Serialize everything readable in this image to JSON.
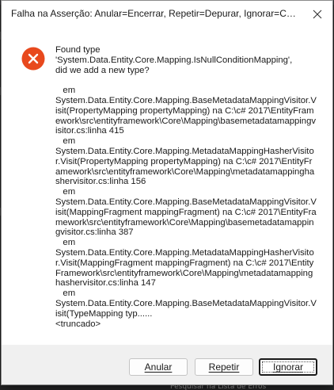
{
  "dialog": {
    "title": "Falha na Asserção: Anular=Encerrar, Repetir=Depurar, Ignorar=Continuar",
    "message": "Found type\n'System.Data.Entity.Core.Mapping.IsNullConditionMapping',\ndid we add a new type?\n\n   em\nSystem.Data.Entity.Core.Mapping.BaseMetadataMappingVisitor.Visit(PropertyMapping propertyMapping) na C:\\c# 2017\\EntityFramework\\src\\entityframework\\Core\\Mapping\\basemetadatamappingvisitor.cs:linha 415\n   em\nSystem.Data.Entity.Core.Mapping.MetadataMappingHasherVisitor.Visit(PropertyMapping propertyMapping) na C:\\c# 2017\\EntityFramework\\src\\entityframework\\Core\\Mapping\\metadatamappinghashervisitor.cs:linha 156\n   em\nSystem.Data.Entity.Core.Mapping.BaseMetadataMappingVisitor.Visit(MappingFragment mappingFragment) na C:\\c# 2017\\EntityFramework\\src\\entityframework\\Core\\Mapping\\basemetadatamappingvisitor.cs:linha 387\n   em\nSystem.Data.Entity.Core.Mapping.MetadataMappingHasherVisitor.Visit(MappingFragment mappingFragment) na C:\\c# 2017\\EntityFramework\\src\\entityframework\\Core\\Mapping\\metadatamappinghashervisitor.cs:linha 147\n   em\nSystem.Data.Entity.Core.Mapping.BaseMetadataMappingVisitor.Visit(TypeMapping typ......\n<truncado>",
    "icon": "error-icon",
    "close_icon": "close-icon"
  },
  "buttons": {
    "abort": "Anular",
    "retry": "Repetir",
    "ignore": "Ignorar"
  },
  "background": {
    "status_text": "Pesquisar na Lista de Erros"
  },
  "colors": {
    "error_red": "#e8491d",
    "dialog_bg": "#ffffff",
    "footer_bg": "#f0f0f0"
  }
}
